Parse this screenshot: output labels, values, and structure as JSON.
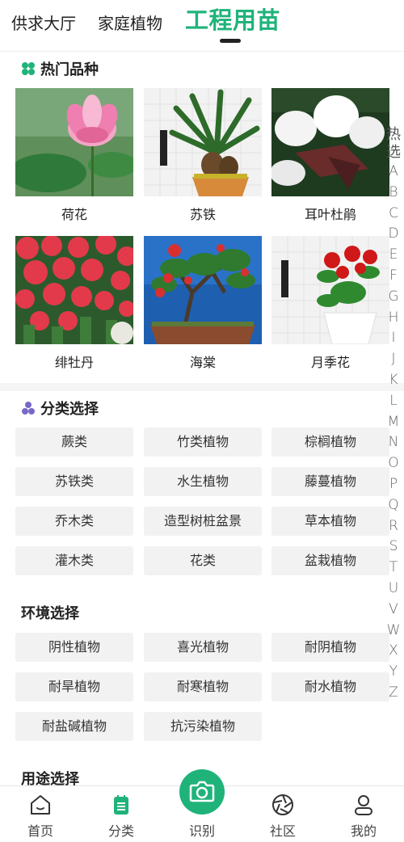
{
  "top_tabs": [
    {
      "label": "供求大厅"
    },
    {
      "label": "家庭植物"
    },
    {
      "label": "工程用苗"
    }
  ],
  "hot": {
    "title": "热门品种",
    "items": [
      {
        "name": "荷花"
      },
      {
        "name": "苏铁"
      },
      {
        "name": "耳叶杜鹃"
      },
      {
        "name": "绯牡丹"
      },
      {
        "name": "海棠"
      },
      {
        "name": "月季花"
      }
    ]
  },
  "category": {
    "title": "分类选择",
    "items": [
      "蕨类",
      "竹类植物",
      "棕榈植物",
      "苏铁类",
      "水生植物",
      "藤蔓植物",
      "乔木类",
      "造型树桩盆景",
      "草本植物",
      "灌木类",
      "花类",
      "盆栽植物"
    ]
  },
  "environment": {
    "title": "环境选择",
    "items": [
      "阴性植物",
      "喜光植物",
      "耐阴植物",
      "耐旱植物",
      "耐寒植物",
      "耐水植物",
      "耐盐碱植物",
      "抗污染植物"
    ]
  },
  "usage": {
    "title": "用途选择"
  },
  "index_bar": {
    "head": [
      "热",
      "选"
    ],
    "letters": [
      "A",
      "B",
      "C",
      "D",
      "E",
      "F",
      "G",
      "H",
      "I",
      "J",
      "K",
      "L",
      "M",
      "N",
      "O",
      "P",
      "Q",
      "R",
      "S",
      "T",
      "U",
      "V",
      "W",
      "X",
      "Y",
      "Z"
    ]
  },
  "bottom_nav": [
    {
      "label": "首页",
      "icon": "home-icon"
    },
    {
      "label": "分类",
      "icon": "category-icon"
    },
    {
      "label": "识别",
      "icon": "camera-icon"
    },
    {
      "label": "社区",
      "icon": "community-icon"
    },
    {
      "label": "我的",
      "icon": "profile-icon"
    }
  ],
  "colors": {
    "accent": "#1fb37a",
    "chip_bg": "#f2f2f2"
  }
}
